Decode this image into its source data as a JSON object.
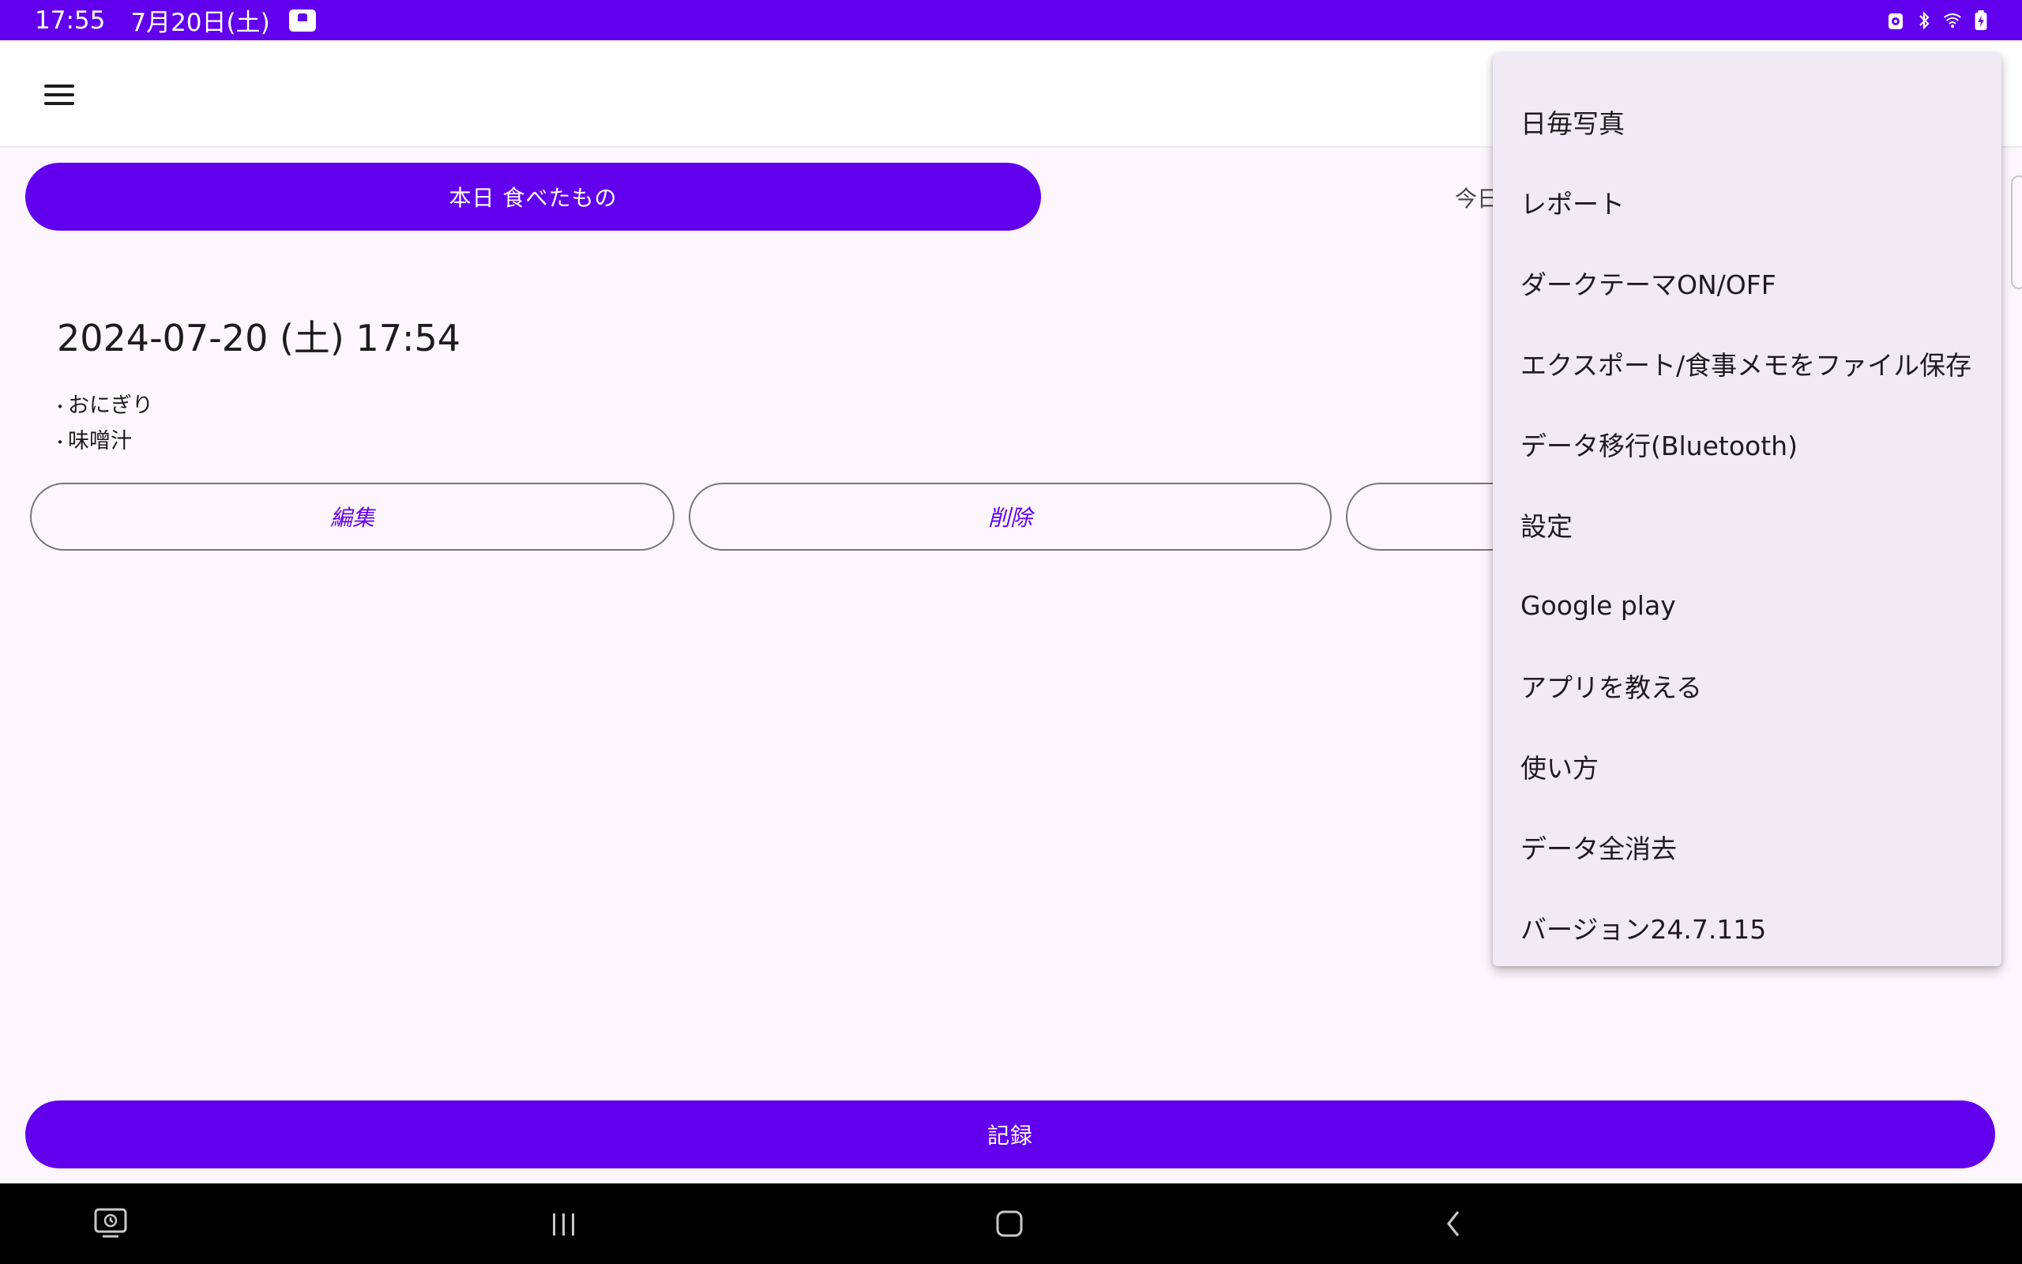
{
  "status_bar": {
    "time": "17:55",
    "date": "7月20日(土)",
    "notification_icon": "app-notification-icon",
    "system_icons": [
      "alarm-icon",
      "bluetooth-icon",
      "wifi-icon",
      "battery-charging-icon"
    ]
  },
  "app_bar": {
    "menu_icon": "hamburger-menu-icon"
  },
  "main": {
    "top_button_label": "本日 食べたもの",
    "today_label_partial": "今日",
    "entry": {
      "datetime": "2024-07-20 (土) 17:54",
      "items": [
        "おにぎり",
        "味噌汁"
      ]
    },
    "actions": {
      "edit_label": "編集",
      "delete_label": "削除"
    },
    "record_label": "記録"
  },
  "menu": {
    "items": [
      "日毎写真",
      "レポート",
      "ダークテーマON/OFF",
      "エクスポート/食事メモをファイル保存",
      "データ移行(Bluetooth)",
      "設定",
      "Google play",
      "アプリを教える",
      "使い方",
      "データ全消去",
      "バージョン24.7.115"
    ]
  },
  "nav_bar": {
    "icons": [
      "recent-screenshot-icon",
      "recent-apps-icon",
      "home-icon",
      "back-icon"
    ]
  },
  "colors": {
    "primary": "#6200ee",
    "background": "#fdf6fc",
    "menu_background": "#f0eaf4",
    "nav_background": "#000000"
  }
}
